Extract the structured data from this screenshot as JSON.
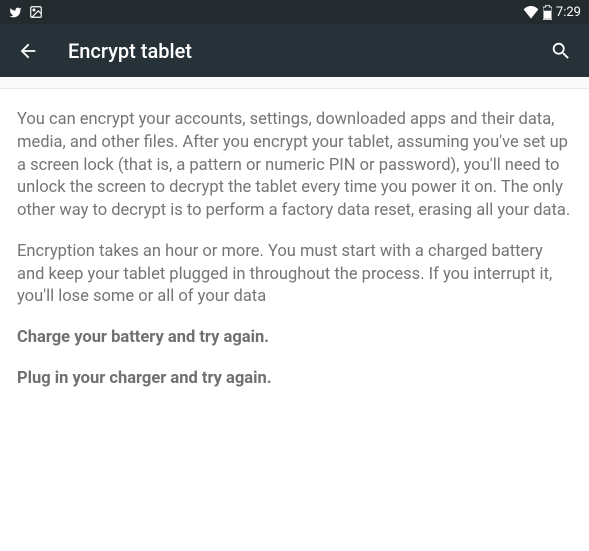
{
  "statusBar": {
    "time": "7:29"
  },
  "appBar": {
    "title": "Encrypt tablet"
  },
  "content": {
    "paragraph1": "You can encrypt your accounts, settings, downloaded apps and their data, media, and other files. After you encrypt your tablet, assuming you've set up a screen lock (that is, a pattern or numeric PIN or password), you'll need to unlock the screen to decrypt the tablet every time you power it on. The only other way to decrypt is to perform a factory data reset, erasing all your data.",
    "paragraph2": "Encryption takes an hour or more. You must start with a charged battery and keep your tablet plugged in throughout the process. If you interrupt it, you'll lose some or all of your data",
    "warning1": "Charge your battery and try again.",
    "warning2": "Plug in your charger and try again."
  }
}
